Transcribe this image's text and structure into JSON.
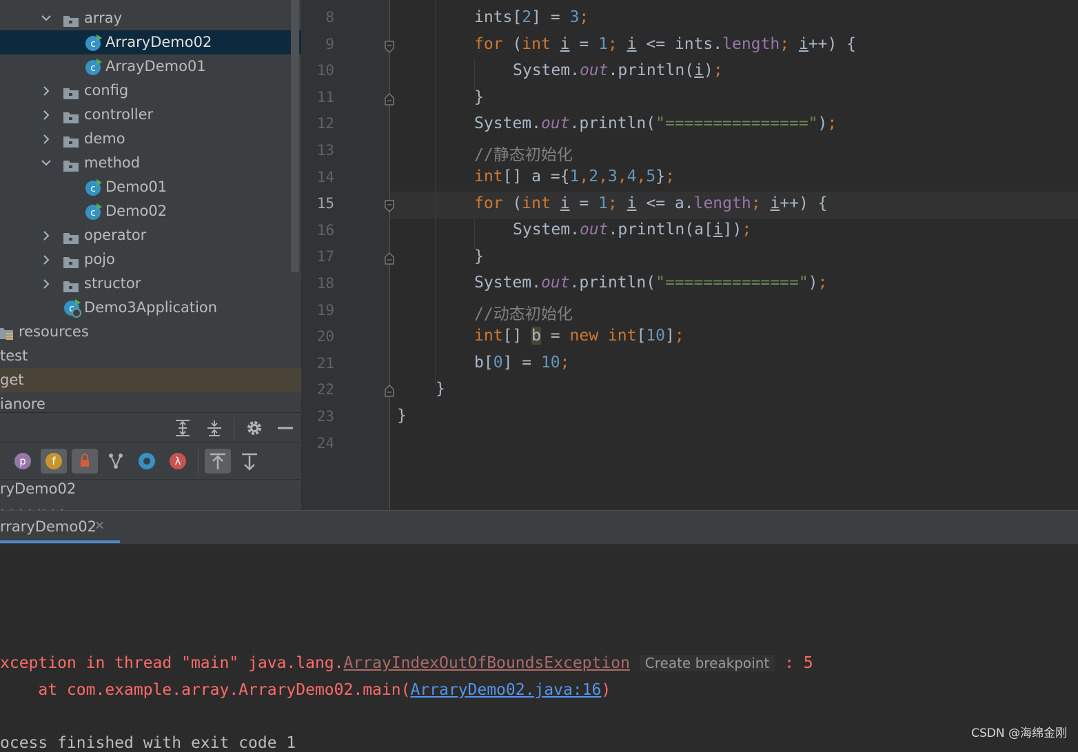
{
  "project_tree": {
    "items": [
      {
        "label": "array",
        "type": "folder",
        "expanded": true
      },
      {
        "label": "ArraryDemo02",
        "type": "class",
        "selected": true
      },
      {
        "label": "ArrayDemo01",
        "type": "class"
      },
      {
        "label": "config",
        "type": "folder",
        "expanded": false
      },
      {
        "label": "controller",
        "type": "folder",
        "expanded": false
      },
      {
        "label": "demo",
        "type": "folder",
        "expanded": false
      },
      {
        "label": "method",
        "type": "folder",
        "expanded": true
      },
      {
        "label": "Demo01",
        "type": "class"
      },
      {
        "label": "Demo02",
        "type": "class"
      },
      {
        "label": "operator",
        "type": "folder",
        "expanded": false
      },
      {
        "label": "pojo",
        "type": "folder",
        "expanded": false
      },
      {
        "label": "structor",
        "type": "folder",
        "expanded": false
      },
      {
        "label": "Demo3Application",
        "type": "spring-class"
      },
      {
        "label": "resources",
        "type": "resources-folder"
      },
      {
        "label": "test",
        "type": "folder"
      },
      {
        "label": "get",
        "type": "folder",
        "highlighted": true
      },
      {
        "label": "ianore",
        "type": "file"
      }
    ]
  },
  "structure": {
    "items": [
      "ryDemo02",
      "... ...",
      "..."
    ],
    "first": "ryDemo02",
    "second": "  · ·  ·  ·  ··  · ·  "
  },
  "editor": {
    "current_line": "15",
    "line_numbers": [
      "8",
      "9",
      "10",
      "11",
      "12",
      "13",
      "14",
      "15",
      "16",
      "17",
      "18",
      "19",
      "20",
      "21",
      "22",
      "23",
      "24"
    ]
  },
  "run_panel": {
    "tab_label": "rraryDemo02",
    "close_glyph": "×",
    "console": {
      "line1_prefix": "xception in thread \"main\" java.lang.",
      "line1_exception": "ArrayIndexOutOfBoundsException",
      "line1_hint": "Create breakpoint",
      "line1_suffix": " : 5",
      "line2_prefix": "    at com.example.array.ArraryDemo02.main(",
      "line2_link": "ArraryDemo02.java:16",
      "line2_suffix": ")",
      "line3": "ocess finished with exit code 1"
    }
  },
  "watermark": "CSDN @海绵金刚",
  "colors": {
    "keyword": "#cc7832",
    "number": "#6897bb",
    "field": "#9876aa",
    "string": "#6a8759",
    "comment": "#808080",
    "error": "#ff6b68",
    "link": "#5394ec",
    "selection": "#0d293e"
  },
  "icons": [
    "folder-icon",
    "java-class-icon",
    "spring-app-icon",
    "resources-folder-icon",
    "expand-all-icon",
    "collapse-all-icon",
    "gear-icon",
    "minimize-icon",
    "properties-icon",
    "fields-icon",
    "non-public-icon",
    "inherited-icon",
    "anonymous-icon",
    "lambda-icon",
    "autoscroll-to-source-icon",
    "autoscroll-from-source-icon"
  ]
}
